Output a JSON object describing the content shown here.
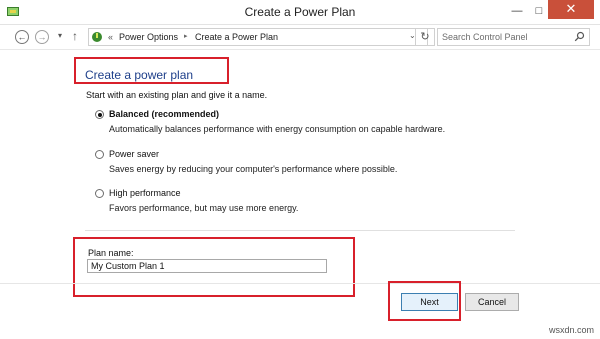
{
  "window": {
    "title": "Create a Power Plan",
    "minimize_glyph": "—",
    "maximize_glyph": "□",
    "close_glyph": "✕"
  },
  "navigation": {
    "back_glyph": "←",
    "forward_glyph": "→",
    "recent_glyph": "▾",
    "up_glyph": "↑"
  },
  "address": {
    "separator": "«",
    "breadcrumbs": [
      "Power Options",
      "Create a Power Plan"
    ],
    "crumb_arrow": "▸",
    "dropdown_glyph": "⌄",
    "refresh_glyph": "↻"
  },
  "search": {
    "placeholder": "Search Control Panel"
  },
  "page": {
    "title": "Create a power plan",
    "intro": "Start with an existing plan and give it a name."
  },
  "plans": [
    {
      "label": "Balanced (recommended)",
      "description": "Automatically balances performance with energy consumption on capable hardware.",
      "selected": true
    },
    {
      "label": "Power saver",
      "description": "Saves energy by reducing your computer's performance where possible.",
      "selected": false
    },
    {
      "label": "High performance",
      "description": "Favors performance, but may use more energy.",
      "selected": false
    }
  ],
  "plan_name": {
    "label": "Plan name:",
    "value": "My Custom Plan 1"
  },
  "buttons": {
    "next": "Next",
    "cancel": "Cancel"
  },
  "watermark": "wsxdn.com",
  "colors": {
    "highlight_border": "#d8202b",
    "title_blue": "#1e3f8a",
    "close_button": "#c9503a"
  }
}
